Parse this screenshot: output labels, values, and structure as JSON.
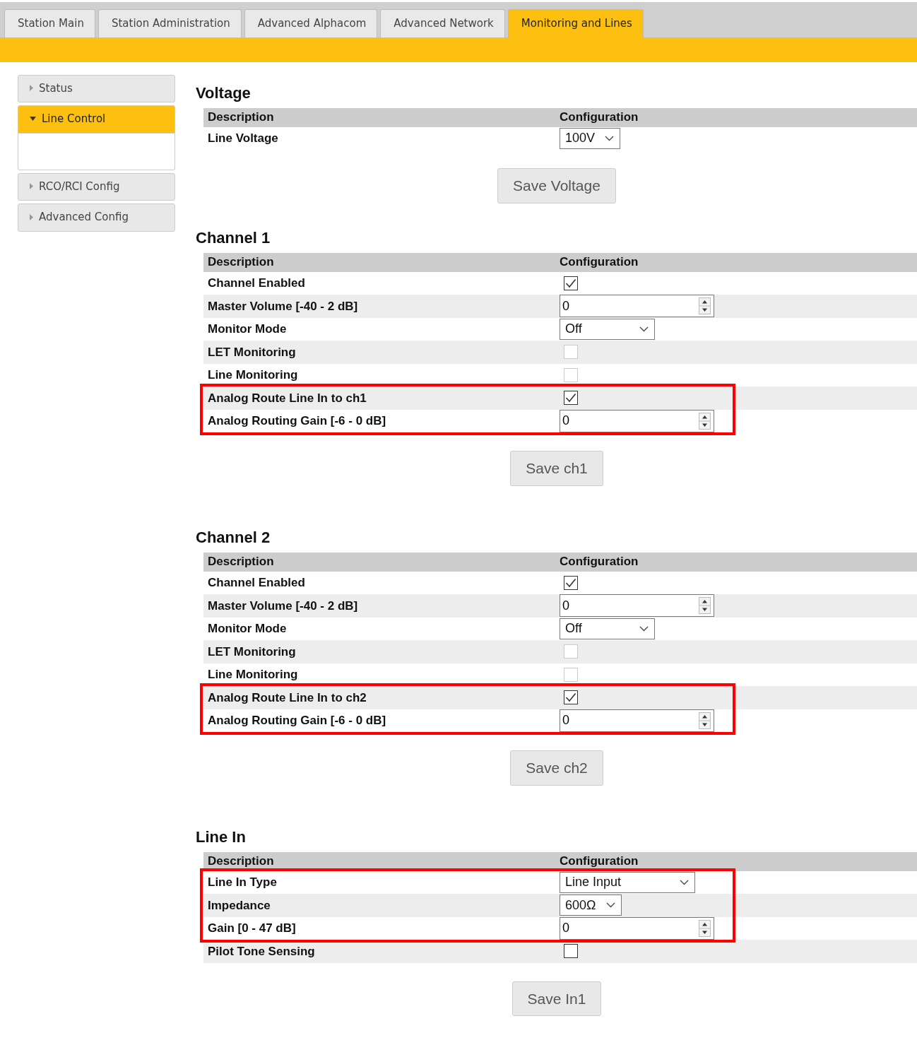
{
  "tabs": [
    {
      "label": "Station Main",
      "selected": false
    },
    {
      "label": "Station Administration",
      "selected": false
    },
    {
      "label": "Advanced Alphacom",
      "selected": false
    },
    {
      "label": "Advanced Network",
      "selected": false
    },
    {
      "label": "Monitoring and Lines",
      "selected": true
    }
  ],
  "sidebar": {
    "items": [
      {
        "label": "Status",
        "selected": false,
        "expanded": false
      },
      {
        "label": "Line Control",
        "selected": true,
        "expanded": true
      },
      {
        "label": "RCO/RCI Config",
        "selected": false,
        "expanded": false
      },
      {
        "label": "Advanced Config",
        "selected": false,
        "expanded": false
      }
    ]
  },
  "sections": [
    {
      "title": "Voltage",
      "columns": [
        "Description",
        "Configuration"
      ],
      "rows": [
        {
          "kind": "select",
          "label": "Line Voltage",
          "value": "100V",
          "highlighted": false
        }
      ],
      "button": "Save Voltage"
    },
    {
      "title": "Channel 1",
      "columns": [
        "Description",
        "Configuration"
      ],
      "rows": [
        {
          "kind": "checkbox",
          "label": "Channel Enabled",
          "checked": true,
          "disabled": false,
          "highlighted": false
        },
        {
          "kind": "number",
          "label": "Master Volume [-40 - 2 dB]",
          "value": "0",
          "highlighted": false
        },
        {
          "kind": "select",
          "label": "Monitor Mode",
          "value": "Off",
          "highlighted": false
        },
        {
          "kind": "checkbox",
          "label": "LET Monitoring",
          "checked": false,
          "disabled": true,
          "highlighted": false
        },
        {
          "kind": "checkbox",
          "label": "Line Monitoring",
          "checked": false,
          "disabled": true,
          "highlighted": false
        },
        {
          "kind": "checkbox",
          "label": "Analog Route Line In to ch1",
          "checked": true,
          "disabled": false,
          "highlighted": true
        },
        {
          "kind": "number",
          "label": "Analog Routing Gain [-6 - 0 dB]",
          "value": "0",
          "highlighted": true
        }
      ],
      "button": "Save ch1"
    },
    {
      "title": "Channel 2",
      "columns": [
        "Description",
        "Configuration"
      ],
      "rows": [
        {
          "kind": "checkbox",
          "label": "Channel Enabled",
          "checked": true,
          "disabled": false,
          "highlighted": false
        },
        {
          "kind": "number",
          "label": "Master Volume [-40 - 2 dB]",
          "value": "0",
          "highlighted": false
        },
        {
          "kind": "select",
          "label": "Monitor Mode",
          "value": "Off",
          "highlighted": false
        },
        {
          "kind": "checkbox",
          "label": "LET Monitoring",
          "checked": false,
          "disabled": true,
          "highlighted": false
        },
        {
          "kind": "checkbox",
          "label": "Line Monitoring",
          "checked": false,
          "disabled": true,
          "highlighted": false
        },
        {
          "kind": "checkbox",
          "label": "Analog Route Line In to ch2",
          "checked": true,
          "disabled": false,
          "highlighted": true
        },
        {
          "kind": "number",
          "label": "Analog Routing Gain [-6 - 0 dB]",
          "value": "0",
          "highlighted": true
        }
      ],
      "button": "Save ch2"
    },
    {
      "title": "Line In",
      "columns": [
        "Description",
        "Configuration"
      ],
      "rows": [
        {
          "kind": "select",
          "label": "Line In Type",
          "value": "Line Input",
          "highlighted": true
        },
        {
          "kind": "select",
          "label": "Impedance",
          "value": "600Ω",
          "highlighted": true
        },
        {
          "kind": "number",
          "label": "Gain [0 - 47 dB]",
          "value": "0",
          "highlighted": true
        },
        {
          "kind": "checkbox",
          "label": "Pilot Tone Sensing",
          "checked": false,
          "disabled": false,
          "highlighted": false
        }
      ],
      "button": "Save In1"
    }
  ]
}
